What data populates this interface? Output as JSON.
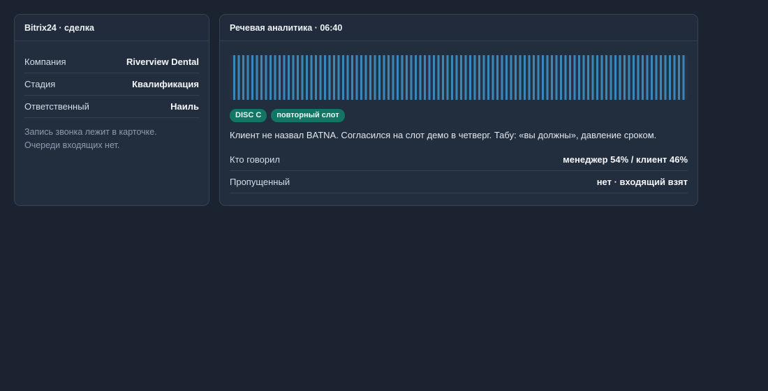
{
  "crm": {
    "title": "Bitrix24 · сделка",
    "rows": [
      {
        "label": "Компания",
        "value": "Riverview Dental"
      },
      {
        "label": "Стадия",
        "value": "Квалификация"
      },
      {
        "label": "Ответственный",
        "value": "Наиль"
      }
    ],
    "note_line1": "Запись звонка лежит в карточке.",
    "note_line2": "Очереди входящих нет."
  },
  "speech": {
    "title": "Речевая аналитика · 06:40",
    "waveform_color": "#3b87b8",
    "tags": [
      "DISC C",
      "повторный слот"
    ],
    "summary": "Клиент не назвал BATNA. Согласился на слот демо в четверг. Табу: «вы должны», давление сроком.",
    "stats": [
      {
        "label": "Кто говорил",
        "value": "менеджер 54% / клиент 46%"
      },
      {
        "label": "Пропущенный",
        "value": "нет · входящий взят"
      }
    ]
  }
}
